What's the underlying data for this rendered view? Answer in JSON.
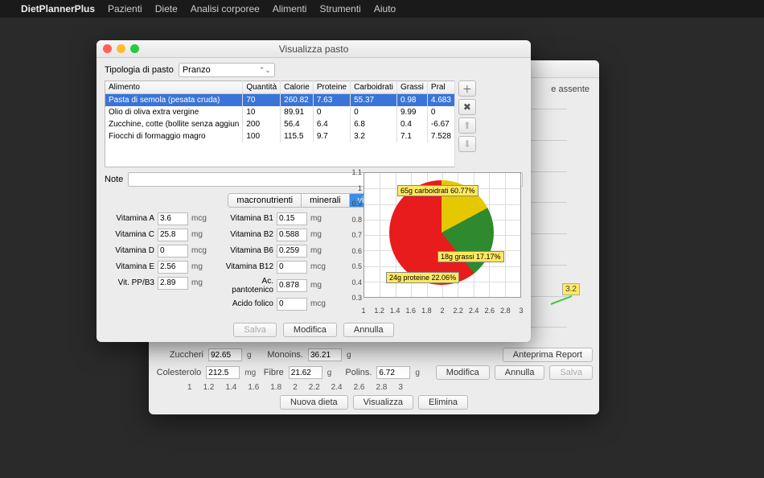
{
  "menubar": {
    "app": "DietPlannerPlus",
    "items": [
      "Pazienti",
      "Diete",
      "Analisi corporee",
      "Alimenti",
      "Strumenti",
      "Aiuto"
    ]
  },
  "back_window": {
    "top_right_text": "e assente",
    "badge_value": "3.2",
    "fields": {
      "zuccheri_label": "Zuccheri",
      "zuccheri": "92.65",
      "zuccheri_unit": "g",
      "monoins_label": "Monoins.",
      "monoins": "36.21",
      "monoins_unit": "g",
      "colesterolo_label": "Colesterolo",
      "colesterolo": "212.5",
      "colesterolo_unit": "mg",
      "fibre_label": "Fibre",
      "fibre": "21.62",
      "fibre_unit": "g",
      "polins_label": "Polins.",
      "polins": "6.72",
      "polins_unit": "g"
    },
    "ticks": [
      "1",
      "1.2",
      "1.4",
      "1.6",
      "1.8",
      "2",
      "2.2",
      "2.4",
      "2.6",
      "2.8",
      "3"
    ],
    "buttons": {
      "nuova_dieta": "Nuova dieta",
      "visualizza": "Visualizza",
      "elimina": "Elimina",
      "anteprima": "Anteprima Report",
      "modifica": "Modifica",
      "annulla": "Annulla",
      "salva": "Salva"
    }
  },
  "front_window": {
    "title": "Visualizza pasto",
    "tipologia_label": "Tipologia di pasto",
    "tipologia_value": "Pranzo",
    "table": {
      "headers": [
        "Alimento",
        "Quantità",
        "Calorie",
        "Proteine",
        "Carboidrati",
        "Grassi",
        "Pral"
      ],
      "rows": [
        {
          "a": "Pasta di semola (pesata cruda)",
          "q": "70",
          "c": "260.82",
          "p": "7.63",
          "cb": "55.37",
          "g": "0.98",
          "pr": "4.683",
          "sel": true
        },
        {
          "a": "Olio di oliva extra vergine",
          "q": "10",
          "c": "89.91",
          "p": "0",
          "cb": "0",
          "g": "9.99",
          "pr": "0"
        },
        {
          "a": "Zucchine, cotte (bollite senza aggiun",
          "q": "200",
          "c": "56.4",
          "p": "6.4",
          "cb": "6.8",
          "g": "0.4",
          "pr": "-6.67"
        },
        {
          "a": "Fiocchi di formaggio magro",
          "q": "100",
          "c": "115.5",
          "p": "9.7",
          "cb": "3.2",
          "g": "7.1",
          "pr": "7.528"
        }
      ]
    },
    "note_label": "Note",
    "tabs": {
      "macro": "macronutrienti",
      "minerali": "minerali",
      "vitamine": "vitamine"
    },
    "vitamins_left": [
      {
        "label": "Vitamina A",
        "val": "3.6",
        "unit": "mcg"
      },
      {
        "label": "Vitamina C",
        "val": "25.8",
        "unit": "mg"
      },
      {
        "label": "Vitamina D",
        "val": "0",
        "unit": "mcg"
      },
      {
        "label": "Vitamina E",
        "val": "2.56",
        "unit": "mg"
      },
      {
        "label": "Vit. PP/B3",
        "val": "2.89",
        "unit": "mg"
      }
    ],
    "vitamins_right": [
      {
        "label": "Vitamina B1",
        "val": "0.15",
        "unit": "mg"
      },
      {
        "label": "Vitamina B2",
        "val": "0.588",
        "unit": "mg"
      },
      {
        "label": "Vitamina B6",
        "val": "0.259",
        "unit": "mg"
      },
      {
        "label": "Vitamina B12",
        "val": "0",
        "unit": "mcg"
      },
      {
        "label": "Ac. pantotenico",
        "val": "0.878",
        "unit": "mg"
      },
      {
        "label": "Acido folico",
        "val": "0",
        "unit": "mcg"
      }
    ],
    "chart_y": [
      "1.1",
      "1",
      "0.9",
      "0.8",
      "0.7",
      "0.6",
      "0.5",
      "0.4",
      "0.3"
    ],
    "chart_x": [
      "1",
      "1.2",
      "1.4",
      "1.6",
      "1.8",
      "2",
      "2.2",
      "2.4",
      "2.6",
      "2.8",
      "3"
    ],
    "pie_labels": {
      "carbo": "65g carboidrati 60.77%",
      "grassi": "18g grassi 17.17%",
      "prot": "24g proteine 22.06%"
    },
    "buttons": {
      "salva": "Salva",
      "modifica": "Modifica",
      "annulla": "Annulla"
    }
  },
  "chart_data": {
    "type": "pie",
    "title": "",
    "series": [
      {
        "name": "carboidrati",
        "grams": 65,
        "percent": 60.77,
        "color": "#e81c1c"
      },
      {
        "name": "proteine",
        "grams": 24,
        "percent": 22.06,
        "color": "#2f8a2f"
      },
      {
        "name": "grassi",
        "grams": 18,
        "percent": 17.17,
        "color": "#e6c800"
      }
    ],
    "xlim": [
      1,
      3
    ],
    "ylim": [
      0.3,
      1.1
    ]
  }
}
